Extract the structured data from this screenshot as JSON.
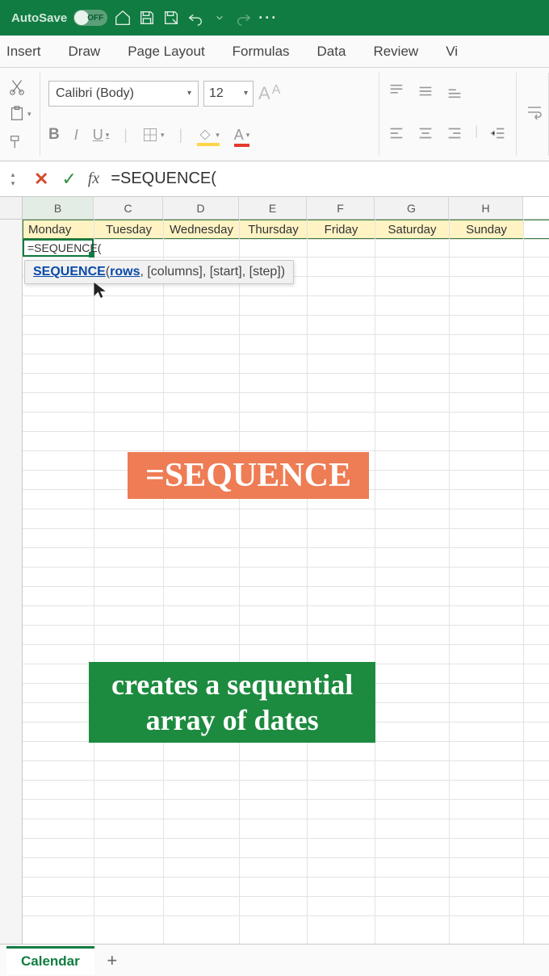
{
  "titlebar": {
    "autosave_label": "AutoSave",
    "autosave_state": "OFF"
  },
  "ribbon_tabs": [
    "Insert",
    "Draw",
    "Page Layout",
    "Formulas",
    "Data",
    "Review",
    "Vi"
  ],
  "font": {
    "name": "Calibri (Body)",
    "size": "12",
    "bold": "B",
    "italic": "I",
    "underline": "U",
    "increase": "A",
    "decrease": "A"
  },
  "formula_bar": {
    "cancel": "✕",
    "confirm": "✓",
    "fx": "fx",
    "text": "=SEQUENCE("
  },
  "columns": [
    "B",
    "C",
    "D",
    "E",
    "F",
    "G",
    "H"
  ],
  "days": {
    "B": "Monday",
    "C": "Tuesday",
    "D": "Wednesday",
    "E": "Thursday",
    "F": "Friday",
    "G": "Saturday",
    "H": "Sunday"
  },
  "active_cell_text": "=SEQUENCE(",
  "tooltip": {
    "fn": "SEQUENCE",
    "open": "(",
    "arg1": "rows",
    "rest": ", [columns], [start], [step])"
  },
  "overlay": {
    "banner1": "=SEQUENCE",
    "banner2_line1": "creates a sequential",
    "banner2_line2": "array of dates"
  },
  "sheet_tab": "Calendar",
  "add_sheet": "+"
}
